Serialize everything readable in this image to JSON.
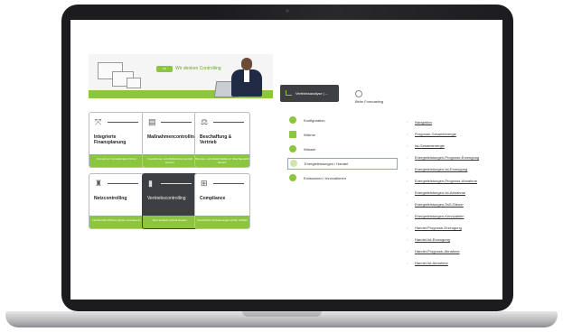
{
  "banner": {
    "logo_badge": "Wt",
    "slogan": "Wir denken Controlling"
  },
  "tiles": [
    {
      "title": "Integrierte Finanzplanung",
      "footer": "Konzerne & Verwaltungen führen",
      "icon": "scale-arrows-icon",
      "glyph": "⤧"
    },
    {
      "title": "Maßnahmencontrolling",
      "footer": "Investitionen und Maßnahmen gezielt steuern",
      "icon": "document-chart-icon",
      "glyph": "▤"
    },
    {
      "title": "Beschaffung & Vertrieb",
      "footer": "Bezugs- und Absatzmärkte im Gleichgewicht steuern",
      "icon": "balance-scale-icon",
      "glyph": "⚖"
    },
    {
      "title": "Netzcontrolling",
      "footer": "Netzbetrieb effizient planen und steuern",
      "icon": "power-pylon-icon",
      "glyph": "♜"
    },
    {
      "title": "Vertriebscontrolling",
      "footer": "Den Vertrieb optimal steuern",
      "icon": "bar-chart-icon",
      "glyph": "▮"
    },
    {
      "title": "Compliance",
      "footer": "Gesetzliche Anforderungen sicher erfüllen",
      "icon": "grid-icon",
      "glyph": "⊞"
    }
  ],
  "tabs": {
    "active": "Vertriebsanalyse | ...",
    "other": "Beim Forecasting"
  },
  "menu": [
    {
      "label": "Konfiguration",
      "selected": false
    },
    {
      "label": "Wärme",
      "selected": false
    },
    {
      "label": "Wasser",
      "selected": false
    },
    {
      "label": "Energieleistungen / Handel",
      "selected": true
    },
    {
      "label": "Emissionen / Innovationen",
      "selected": false
    }
  ],
  "links": [
    "Navigation",
    "Prognose-Gesamtenergie",
    "Ist-Gesamtenergie",
    "Energieleistungen-Prognose-Erzeugung",
    "Energieleistungen-Ist-Erzeugung",
    "Energieleistungen-Prognose-Abnahme",
    "Energieleistungen-Ist-Abnahme",
    "Energieleistungen-TaG-Steuer",
    "Energieleistungen-Kennzahlen",
    "Handel-Prognose-Erzeugung",
    "Handel-Ist-Erzeugung",
    "Handel-Prognose-Abnahme",
    "Handel-Ist-Abnahme"
  ],
  "colors": {
    "accent_green": "#8cc63f",
    "dark_tile": "#3d3f42",
    "laptop_bezel": "#1c1c1e"
  }
}
